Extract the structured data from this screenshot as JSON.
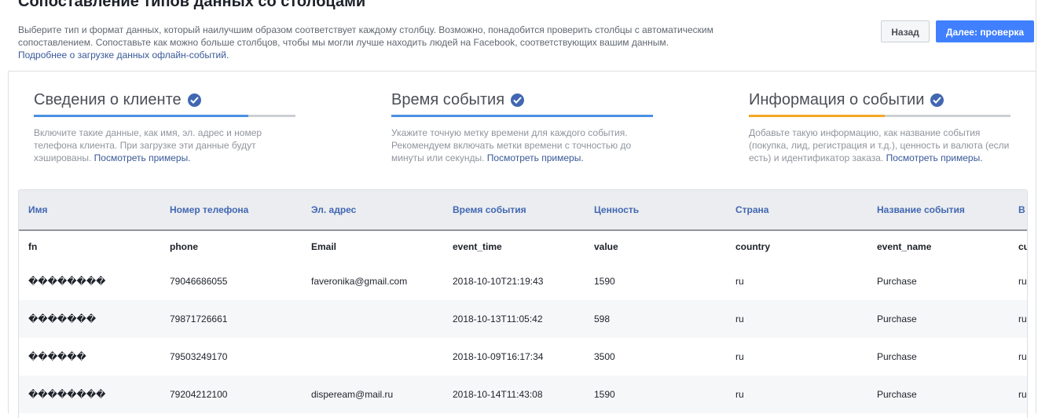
{
  "header": {
    "title": "Сопоставление типов данных со столбцами",
    "description": "Выберите тип и формат данных, который наилучшим образом соответствует каждому столбцу. Возможно, понадобится проверить столбцы с автоматическим сопоставлением. Сопоставьте как можно больше столбцов, чтобы мы могли лучше находить людей на Facebook, соответствующих вашим данным.",
    "learn_more_link": "Подробнее о загрузке данных офлайн-событий.",
    "back_button": "Назад",
    "next_button": "Далее: проверка"
  },
  "steps": [
    {
      "title": "Сведения о клиенте",
      "text": "Включите такие данные, как имя, эл. адрес и номер телефона клиента. При загрузке эти данные будут хэшированы. ",
      "link": "Посмотреть примеры.",
      "progress": 0.82,
      "color": "#4a90e2"
    },
    {
      "title": "Время события",
      "text": "Укажите точную метку времени для каждого события. Рекомендуем включать метки времени с точностью до минуты или секунды. ",
      "link": "Посмотреть примеры.",
      "progress": 1.0,
      "color": "#4a90e2"
    },
    {
      "title": "Информация о событии",
      "text": "Добавьте такую информацию, как название события (покупка, лид, регистрация и т.д.), ценность и валюта (если есть) и идентификатор заказа. ",
      "link": "Посмотреть примеры.",
      "progress": 0.52,
      "color": "#f5a623"
    }
  ],
  "table": {
    "columns": [
      "Имя",
      "Номер телефона",
      "Эл. адрес",
      "Время события",
      "Ценность",
      "Страна",
      "Название события",
      "В"
    ],
    "source_columns": [
      "fn",
      "phone",
      "Email",
      "event_time",
      "value",
      "country",
      "event_name",
      "cu"
    ],
    "rows": [
      [
        "��������",
        "79046686055",
        "faveronika@gmail.com",
        "2018-10-10T21:19:43",
        "1590",
        "ru",
        "Purchase",
        "ru"
      ],
      [
        "�������",
        "79871726661",
        "",
        "2018-10-13T11:05:42",
        "598",
        "ru",
        "Purchase",
        "ru"
      ],
      [
        "������",
        "79503249170",
        "",
        "2018-10-09T16:17:34",
        "3500",
        "ru",
        "Purchase",
        "ru"
      ],
      [
        "��������",
        "79204212100",
        "dispeream@mail.ru",
        "2018-10-14T11:43:08",
        "1590",
        "ru",
        "Purchase",
        "ru"
      ]
    ]
  }
}
